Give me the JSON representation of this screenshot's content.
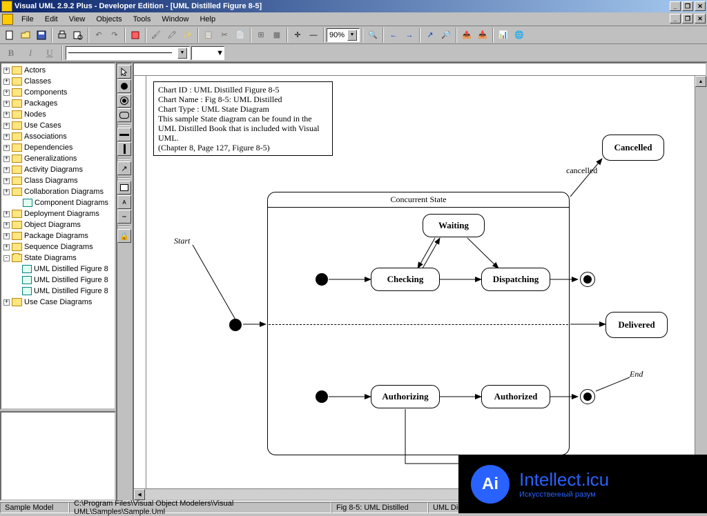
{
  "titlebar": {
    "text": "Visual UML 2.9.2 Plus - Developer Edition - [UML Distilled Figure 8-5]"
  },
  "menu": {
    "items": [
      "File",
      "Edit",
      "View",
      "Objects",
      "Tools",
      "Window",
      "Help"
    ]
  },
  "toolbar": {
    "zoom": "90%"
  },
  "tree": {
    "items": [
      {
        "label": "Actors",
        "type": "folder"
      },
      {
        "label": "Classes",
        "type": "folder"
      },
      {
        "label": "Components",
        "type": "folder"
      },
      {
        "label": "Packages",
        "type": "folder"
      },
      {
        "label": "Nodes",
        "type": "folder"
      },
      {
        "label": "Use Cases",
        "type": "folder"
      },
      {
        "label": "Associations",
        "type": "folder"
      },
      {
        "label": "Dependencies",
        "type": "folder"
      },
      {
        "label": "Generalizations",
        "type": "folder"
      },
      {
        "label": "Activity Diagrams",
        "type": "folder"
      },
      {
        "label": "Class Diagrams",
        "type": "folder"
      },
      {
        "label": "Collaboration Diagrams",
        "type": "folder"
      },
      {
        "label": "Component Diagrams",
        "type": "leaf"
      },
      {
        "label": "Deployment Diagrams",
        "type": "folder"
      },
      {
        "label": "Object Diagrams",
        "type": "folder"
      },
      {
        "label": "Package Diagrams",
        "type": "folder"
      },
      {
        "label": "Sequence Diagrams",
        "type": "folder"
      },
      {
        "label": "State Diagrams",
        "type": "folder-open",
        "children": [
          "UML Distilled Figure 8",
          "UML Distilled Figure 8",
          "UML Distilled Figure 8"
        ]
      },
      {
        "label": "Use Case Diagrams",
        "type": "folder"
      }
    ]
  },
  "info": {
    "l1": "Chart ID : UML Distilled Figure 8-5",
    "l2": "Chart Name : Fig 8-5: UML Distilled",
    "l3": "Chart Type : UML State Diagram",
    "l4": "This sample State diagram can be found in the",
    "l5": "UML Distilled Book that is included with Visual UML.",
    "l6": "(Chapter 8, Page 127, Figure 8-5)"
  },
  "diagram": {
    "concurrent": "Concurrent State",
    "waiting": "Waiting",
    "checking": "Checking",
    "dispatching": "Dispatching",
    "authorizing": "Authorizing",
    "authorized": "Authorized",
    "cancelled": "Cancelled",
    "delivered": "Delivered",
    "start": "Start",
    "end": "End",
    "cancelled_trans": "cancelled"
  },
  "status": {
    "c1": "Sample Model",
    "c2": "C:\\Program Files\\Visual Object Modelers\\Visual UML\\Samples\\Sample.Uml",
    "c3": "Fig 8-5: UML Distilled",
    "c4": "UML Dis"
  },
  "logo": {
    "brand": "Intellect.icu",
    "tag": "Искусственный разум",
    "badge": "Ai"
  }
}
